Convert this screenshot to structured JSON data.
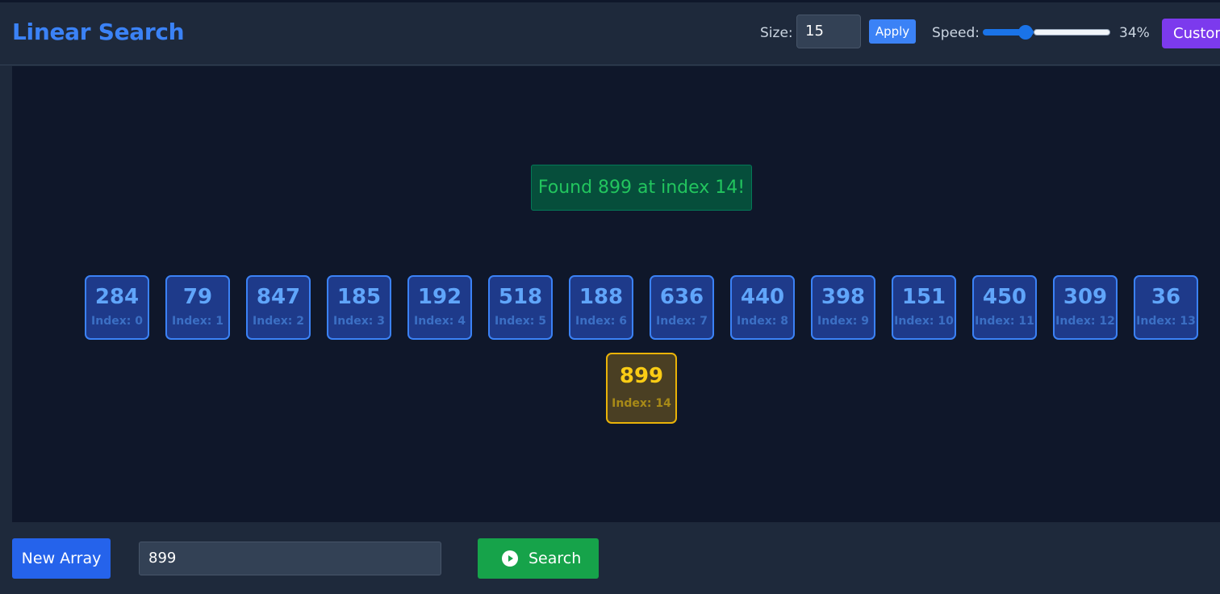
{
  "header": {
    "title": "Linear Search",
    "size_label": "Size:",
    "size_value": "15",
    "apply_label": "Apply",
    "speed_label": "Speed:",
    "speed_value": 34,
    "speed_text": "34%",
    "custom_label": "Custom"
  },
  "main": {
    "status_message": "Found 899 at index 14!",
    "array": [
      {
        "value": "284",
        "index_label": "Index: 0"
      },
      {
        "value": "79",
        "index_label": "Index: 1"
      },
      {
        "value": "847",
        "index_label": "Index: 2"
      },
      {
        "value": "185",
        "index_label": "Index: 3"
      },
      {
        "value": "192",
        "index_label": "Index: 4"
      },
      {
        "value": "518",
        "index_label": "Index: 5"
      },
      {
        "value": "188",
        "index_label": "Index: 6"
      },
      {
        "value": "636",
        "index_label": "Index: 7"
      },
      {
        "value": "440",
        "index_label": "Index: 8"
      },
      {
        "value": "398",
        "index_label": "Index: 9"
      },
      {
        "value": "151",
        "index_label": "Index: 10"
      },
      {
        "value": "450",
        "index_label": "Index: 11"
      },
      {
        "value": "309",
        "index_label": "Index: 12"
      },
      {
        "value": "36",
        "index_label": "Index: 13"
      },
      {
        "value": "899",
        "index_label": "Index: 14",
        "found": true
      }
    ]
  },
  "footer": {
    "new_array_label": "New Array",
    "search_value": "899",
    "search_label": "Search",
    "play_icon": "play-circle-icon"
  },
  "colors": {
    "accent": "#3b82f6",
    "found_text": "#22c55e",
    "found_cell": "#eab308",
    "search_button": "#16a34a",
    "custom_button": "#7c3aed"
  }
}
